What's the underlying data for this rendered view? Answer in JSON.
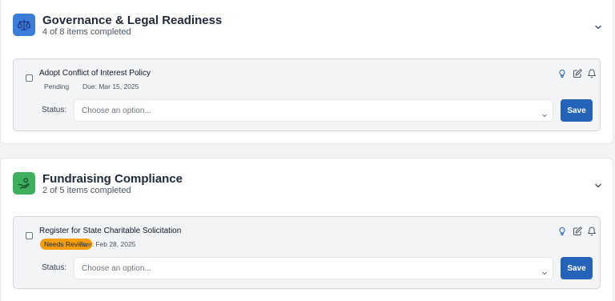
{
  "colors": {
    "accent": "#2563b8",
    "governance_icon_bg": "#3b7dd8",
    "fundraising_icon_bg": "#3fae5d",
    "needs_review_badge": "#f59e0b"
  },
  "sections": [
    {
      "icon": "scale-icon",
      "title": "Governance & Legal Readiness",
      "progress_text": "4 of 8 items completed",
      "items": [
        {
          "title": "Adopt Conflict of Interest Policy",
          "status": "Pending",
          "due": "Due: Mar 15, 2025",
          "status_label": "Status:",
          "select_placeholder": "Choose an option...",
          "save_label": "Save"
        }
      ]
    },
    {
      "icon": "hand-coin-icon",
      "title": "Fundraising Compliance",
      "progress_text": "2 of 5 items completed",
      "items": [
        {
          "title": "Register for State Charitable Solicitation",
          "status": "Needs Review",
          "due": "Due: Feb 28, 2025",
          "status_label": "Status:",
          "select_placeholder": "Choose an option...",
          "save_label": "Save"
        }
      ]
    }
  ]
}
